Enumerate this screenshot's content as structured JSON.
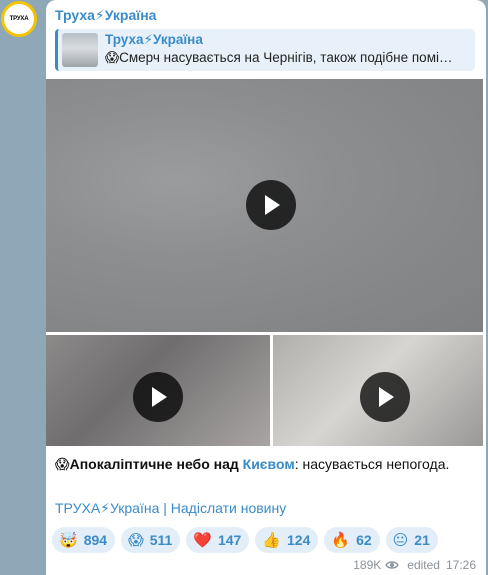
{
  "channel": {
    "avatar_text": "ТРУХА",
    "name": "Труха⚡Україна"
  },
  "reply": {
    "name": "Труха⚡Україна",
    "text": "😱Смерч насувається на Чернігів, також подібне помі…"
  },
  "media": {
    "items": [
      {
        "kind": "video",
        "label": "play"
      },
      {
        "kind": "video",
        "label": "play"
      },
      {
        "kind": "video",
        "label": "play"
      }
    ]
  },
  "caption": {
    "emoji": "😱",
    "bold_text": "Апокаліптичне небо над ",
    "link_text": "Києвом",
    "rest_text": ": насувається непогода."
  },
  "footer": {
    "link_text": "ТРУХА⚡Україна | Надіслати новину"
  },
  "reactions": [
    {
      "emoji": "🤯",
      "count": "894"
    },
    {
      "emoji": "😱",
      "count": "511"
    },
    {
      "emoji": "❤️",
      "count": "147"
    },
    {
      "emoji": "👍",
      "count": "124"
    },
    {
      "emoji": "🔥",
      "count": "62"
    },
    {
      "emoji": "😐",
      "count": "21"
    }
  ],
  "meta": {
    "views": "189K",
    "edited_label": "edited",
    "time": "17:26"
  },
  "colors": {
    "accent": "#3a8bc8",
    "avatar_ring": "#f5c400",
    "reaction_bg": "#e3eef8"
  }
}
